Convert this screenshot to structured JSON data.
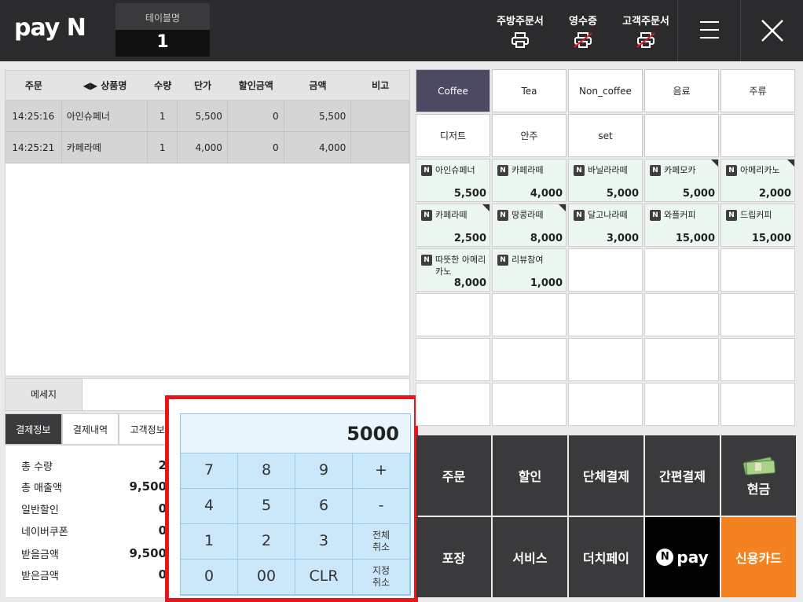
{
  "header": {
    "logo": "pay N",
    "table_label": "테이블명",
    "table_number": "1",
    "kitchen_order": "주방주문서",
    "receipt": "영수증",
    "customer_order": "고객주문서"
  },
  "order": {
    "columns": [
      "주문",
      "◀▶ 상품명",
      "수량",
      "단가",
      "할인금액",
      "금액",
      "비고"
    ],
    "rows": [
      {
        "time": "14:25:16",
        "name": "아인슈페너",
        "qty": "1",
        "unit": "5,500",
        "discount": "0",
        "amount": "5,500",
        "note": ""
      },
      {
        "time": "14:25:21",
        "name": "카페라떼",
        "qty": "1",
        "unit": "4,000",
        "discount": "0",
        "amount": "4,000",
        "note": ""
      }
    ]
  },
  "message": {
    "label": "메세지",
    "value": ""
  },
  "tabs": [
    "결제정보",
    "결제내역",
    "고객정보"
  ],
  "payment_info": {
    "total_qty_label": "총 수량",
    "total_qty": "2",
    "total_sales_label": "총 매출액",
    "total_sales": "9,500",
    "general_discount_label": "일반할인",
    "general_discount": "0",
    "naver_coupon_label": "네이버쿠폰",
    "naver_coupon": "0",
    "received_label": "받을금액",
    "received": "9,500",
    "paid_label": "받은금액",
    "paid": "0"
  },
  "numpad": {
    "display": "5000",
    "keys": [
      "7",
      "8",
      "9",
      "+",
      "4",
      "5",
      "6",
      "-",
      "1",
      "2",
      "3",
      "전체\n취소",
      "0",
      "00",
      "CLR",
      "지정\n취소"
    ]
  },
  "categories": [
    "Coffee",
    "Tea",
    "Non_coffee",
    "음료",
    "주류",
    "디저트",
    "안주",
    "set",
    "",
    ""
  ],
  "products": [
    {
      "name": "아인슈페너",
      "price": "5,500",
      "corner": false
    },
    {
      "name": "카페라떼",
      "price": "4,000",
      "corner": false
    },
    {
      "name": "바닐라라떼",
      "price": "5,000",
      "corner": false
    },
    {
      "name": "카페모카",
      "price": "5,000",
      "corner": true
    },
    {
      "name": "아메리카노",
      "price": "2,000",
      "corner": true
    },
    {
      "name": "카페라떼",
      "price": "2,500",
      "corner": true
    },
    {
      "name": "땅콩라떼",
      "price": "8,000",
      "corner": true
    },
    {
      "name": "달고나라떼",
      "price": "3,000",
      "corner": false
    },
    {
      "name": "와플커피",
      "price": "15,000",
      "corner": false
    },
    {
      "name": "드립커피",
      "price": "15,000",
      "corner": false
    },
    {
      "name": "따뜻한 아메리카노",
      "price": "8,000",
      "corner": false
    },
    {
      "name": "리뷰참여",
      "price": "1,000",
      "corner": false
    }
  ],
  "actions": [
    "주문",
    "할인",
    "단체결제",
    "간편결제",
    "현금",
    "포장",
    "서비스",
    "더치페이",
    "pay",
    "신용카드"
  ],
  "colors": {
    "accent_category": "#4c4a63",
    "card": "#f58220",
    "numpad_border": "#e8161a"
  }
}
